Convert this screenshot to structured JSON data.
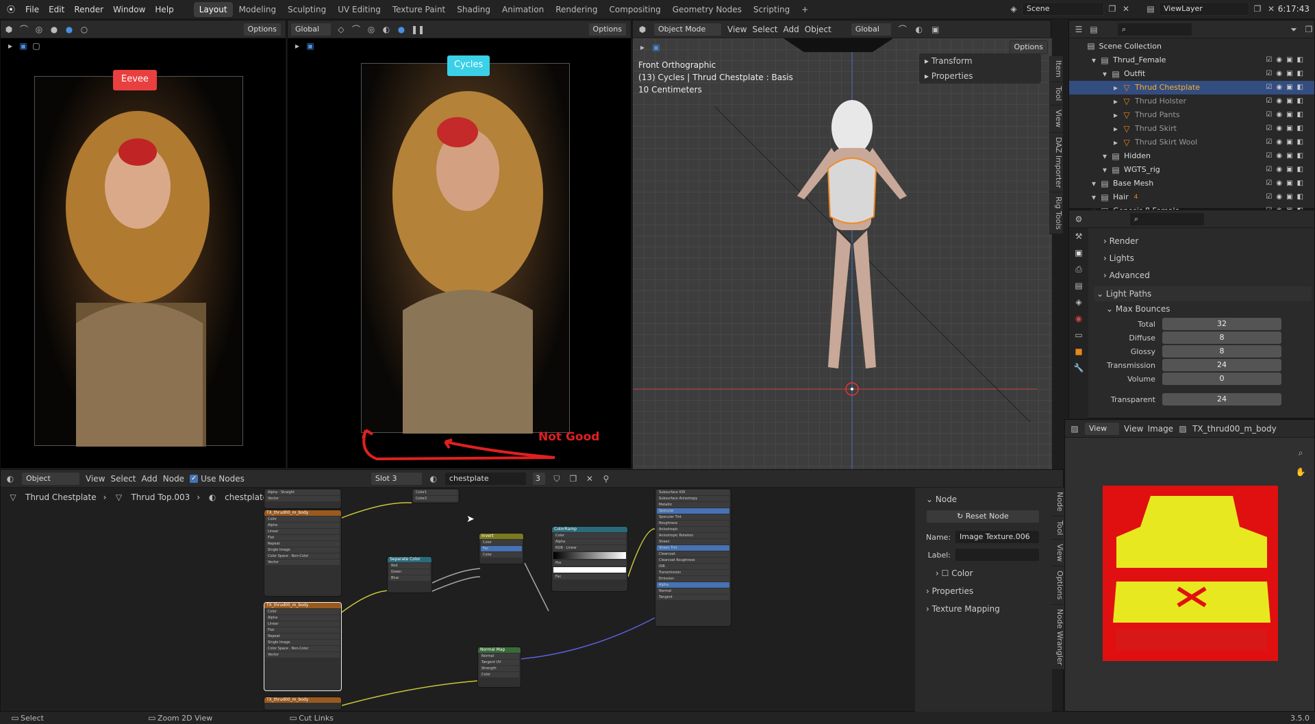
{
  "topbar": {
    "menus": [
      "File",
      "Edit",
      "Render",
      "Window",
      "Help"
    ],
    "workspaces": [
      "Layout",
      "Modeling",
      "Sculpting",
      "UV Editing",
      "Texture Paint",
      "Shading",
      "Animation",
      "Rendering",
      "Compositing",
      "Geometry Nodes",
      "Scripting"
    ],
    "active_workspace": "Layout",
    "add": "+",
    "scene": "Scene",
    "view_layer": "ViewLayer",
    "time": "6:17:43"
  },
  "left_view": {
    "orientation": "Global",
    "options": "Options",
    "badge": "Eevee",
    "badge_color": "#e84040"
  },
  "mid_view": {
    "orientation": "Global",
    "options": "Options",
    "badge": "Cycles",
    "badge_color": "#3ad0e8",
    "annotation": "Not Good",
    "annotation_color": "#e02020"
  },
  "viewport3d": {
    "mode": "Object Mode",
    "menus": [
      "View",
      "Select",
      "Add",
      "Object"
    ],
    "orientation": "Global",
    "options": "Options",
    "info_line1": "Front Orthographic",
    "info_line2": "(13) Cycles | Thrud Chestplate : Basis",
    "info_line3": "10 Centimeters",
    "n_panel": [
      "Transform",
      "Properties"
    ],
    "side_tabs": [
      "Item",
      "Tool",
      "View",
      "DAZ Importer",
      "Rig Tools"
    ]
  },
  "outliner": {
    "title": "Scene Collection",
    "items": [
      {
        "label": "Thrud_Female",
        "depth": 1,
        "kind": "collection"
      },
      {
        "label": "Outfit",
        "depth": 2,
        "kind": "collection"
      },
      {
        "label": "Thrud Chestplate",
        "depth": 3,
        "kind": "mesh",
        "selected": true
      },
      {
        "label": "Thrud Holster",
        "depth": 3,
        "kind": "mesh"
      },
      {
        "label": "Thrud Pants",
        "depth": 3,
        "kind": "mesh"
      },
      {
        "label": "Thrud Skirt",
        "depth": 3,
        "kind": "mesh"
      },
      {
        "label": "Thrud Skirt Wool",
        "depth": 3,
        "kind": "mesh"
      },
      {
        "label": "Hidden",
        "depth": 2,
        "kind": "collection"
      },
      {
        "label": "WGTS_rig",
        "depth": 2,
        "kind": "collection"
      },
      {
        "label": "Base Mesh",
        "depth": 1,
        "kind": "collection"
      },
      {
        "label": "Hair",
        "depth": 1,
        "kind": "collection",
        "count": "4"
      },
      {
        "label": "Genesis 8 Female",
        "depth": 1,
        "kind": "collection"
      }
    ]
  },
  "properties": {
    "sections": [
      "Render",
      "Lights",
      "Advanced"
    ],
    "light_paths": "Light Paths",
    "max_bounces": "Max Bounces",
    "fields": [
      {
        "label": "Total",
        "value": "32"
      },
      {
        "label": "Diffuse",
        "value": "8"
      },
      {
        "label": "Glossy",
        "value": "8"
      },
      {
        "label": "Transmission",
        "value": "24"
      },
      {
        "label": "Volume",
        "value": "0"
      },
      {
        "label": "Transparent",
        "value": "24"
      }
    ]
  },
  "node_editor": {
    "type": "Object",
    "menus": [
      "View",
      "Select",
      "Add",
      "Node"
    ],
    "use_nodes": "Use Nodes",
    "slot": "Slot 3",
    "material": "chestplate",
    "users": "3",
    "breadcrumb": [
      "Thrud Chestplate",
      "Thrud Top.003",
      "chestplate"
    ]
  },
  "node_panel": {
    "section": "Node",
    "reset": "Reset Node",
    "name_label": "Name:",
    "name_value": "Image Texture.006",
    "label_label": "Label:",
    "label_value": "",
    "color": "Color",
    "properties": "Properties",
    "texture_mapping": "Texture Mapping",
    "tabs": [
      "Node",
      "Tool",
      "View",
      "Options",
      "Node Wrangler"
    ]
  },
  "image_editor": {
    "menus": [
      "View",
      "Image"
    ],
    "view_mode": "View",
    "image_name": "TX_thrud00_m_body"
  },
  "statusbar": {
    "select": "Select",
    "zoom": "Zoom 2D View",
    "cut": "Cut Links",
    "version": "3.5.0"
  }
}
